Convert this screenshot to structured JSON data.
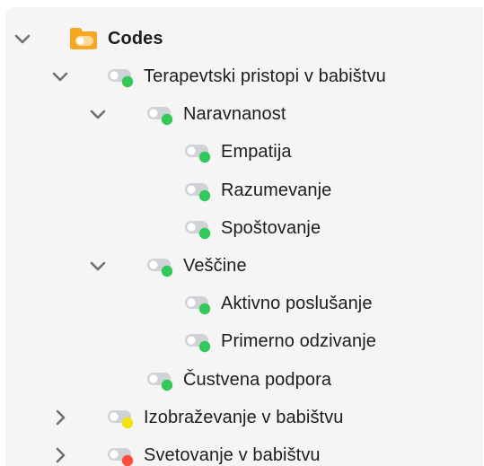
{
  "tree": {
    "root": {
      "label": "Codes",
      "expanded": true,
      "icon": "folder-code-icon",
      "icon_color": "#f5a623"
    },
    "items": [
      {
        "label": "Terapevtski pristopi v babištvu",
        "depth": 1,
        "chevron": "down",
        "status_color": "#34c759"
      },
      {
        "label": "Naravnanost",
        "depth": 2,
        "chevron": "down",
        "status_color": "#34c759"
      },
      {
        "label": "Empatija",
        "depth": 3,
        "chevron": "none",
        "status_color": "#34c759"
      },
      {
        "label": "Razumevanje",
        "depth": 3,
        "chevron": "none",
        "status_color": "#34c759"
      },
      {
        "label": "Spoštovanje",
        "depth": 3,
        "chevron": "none",
        "status_color": "#34c759"
      },
      {
        "label": "Veščine",
        "depth": 2,
        "chevron": "down",
        "status_color": "#34c759"
      },
      {
        "label": "Aktivno poslušanje",
        "depth": 3,
        "chevron": "none",
        "status_color": "#34c759"
      },
      {
        "label": "Primerno odzivanje",
        "depth": 3,
        "chevron": "none",
        "status_color": "#34c759"
      },
      {
        "label": "Čustvena podpora",
        "depth": 2,
        "chevron": "none",
        "status_color": "#34c759"
      },
      {
        "label": "Izobraževanje v babištvu",
        "depth": 1,
        "chevron": "right",
        "status_color": "#f2e30c"
      },
      {
        "label": "Svetovanje v babištvu",
        "depth": 1,
        "chevron": "right",
        "status_color": "#ff4d3d"
      }
    ]
  }
}
